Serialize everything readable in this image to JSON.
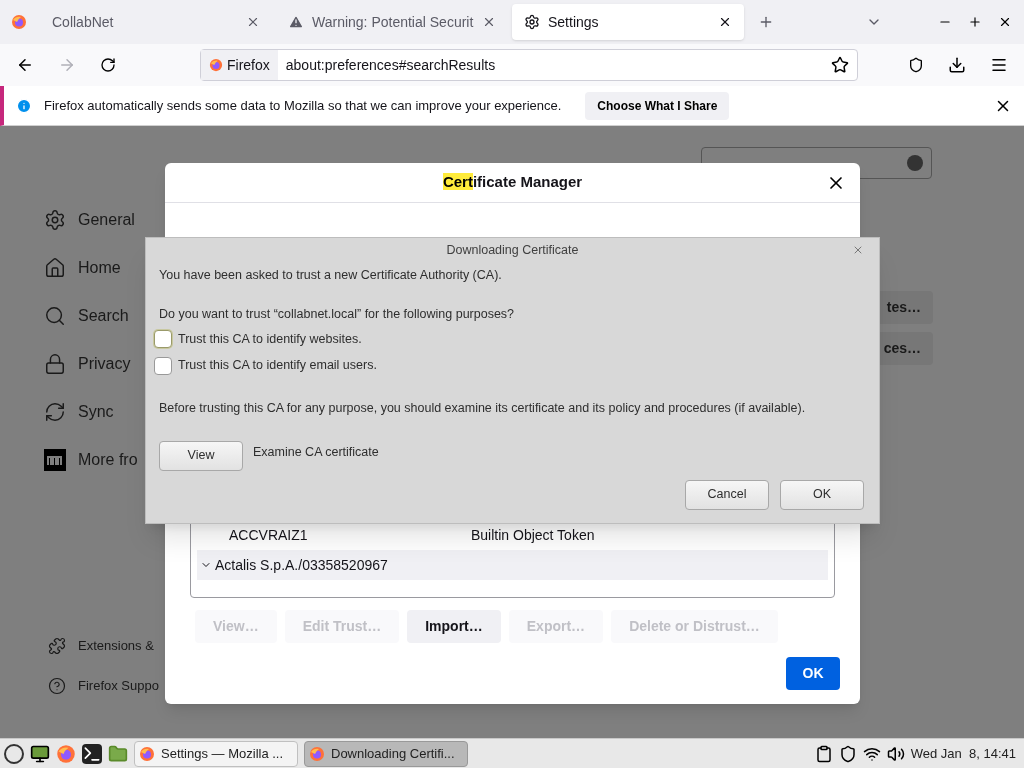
{
  "tabs": [
    {
      "kind": "pinned",
      "selected": false
    },
    {
      "kind": "page",
      "label": "CollabNet",
      "selected": false
    },
    {
      "kind": "page",
      "label": "Warning: Potential Securit",
      "selected": false
    },
    {
      "kind": "page",
      "label": "Settings",
      "selected": true
    }
  ],
  "toolbar": {
    "identity": "Firefox",
    "url": "about:preferences#searchResults"
  },
  "notification": {
    "text": "Firefox automatically sends some data to Mozilla so that we can improve your experience.",
    "button": "Choose What I Share"
  },
  "sidebar": {
    "items": [
      {
        "label": "General"
      },
      {
        "label": "Home"
      },
      {
        "label": "Search"
      },
      {
        "label": "Privacy"
      },
      {
        "label": "Sync"
      },
      {
        "label": "More fro"
      }
    ],
    "footer": [
      {
        "label": "Extensions &"
      },
      {
        "label": "Firefox Suppo"
      }
    ]
  },
  "background_buttons": [
    "tes…",
    "ces…"
  ],
  "certificate_manager": {
    "title_highlight": "Cert",
    "title_rest": "ificate Manager",
    "rows": [
      {
        "kind": "cert",
        "name": "ACCVRAIZ1",
        "device": "Builtin Object Token",
        "selected": false
      },
      {
        "kind": "group",
        "name": "Actalis S.p.A./03358520967",
        "expanded": true,
        "selected": true
      }
    ],
    "buttons": [
      {
        "label": "View…",
        "disabled": true
      },
      {
        "label": "Edit Trust…",
        "disabled": true
      },
      {
        "label": "Import…",
        "disabled": false
      },
      {
        "label": "Export…",
        "disabled": true
      },
      {
        "label": "Delete or Distrust…",
        "disabled": true
      }
    ],
    "ok": "OK"
  },
  "download_dialog": {
    "title": "Downloading Certificate",
    "intro": "You have been asked to trust a new Certificate Authority (CA).",
    "question": "Do you want to trust “collabnet.local” for the following purposes?",
    "options": [
      {
        "label": "Trust this CA to identify websites.",
        "checked": false
      },
      {
        "label": "Trust this CA to identify email users.",
        "checked": false
      }
    ],
    "advice": "Before trusting this CA for any purpose, you should examine its certificate and its policy and procedures (if available).",
    "view_button": "View",
    "view_label": "Examine CA certificate",
    "cancel": "Cancel",
    "ok": "OK"
  },
  "taskbar": {
    "windows": [
      {
        "label": "Settings — Mozilla ...",
        "selected": false
      },
      {
        "label": "Downloading Certifi...",
        "selected": true
      }
    ],
    "clock": "Wed Jan  8, 14:41"
  }
}
